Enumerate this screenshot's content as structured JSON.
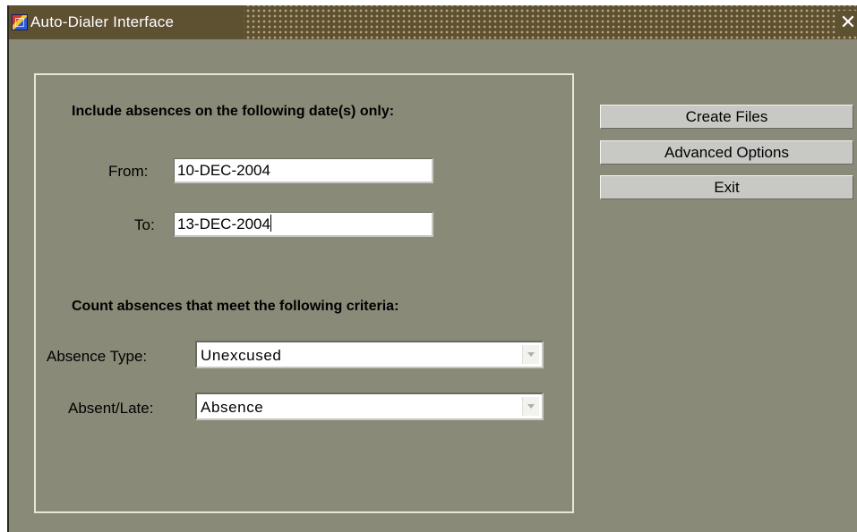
{
  "window": {
    "title": "Auto-Dialer Interface",
    "close_symbol": "✕"
  },
  "date_section": {
    "heading": "Include absences on the following date(s) only:",
    "from_label": "From:",
    "from_value": "10-DEC-2004",
    "to_label": "To:",
    "to_value": "13-DEC-2004"
  },
  "criteria_section": {
    "heading": "Count absences that meet the following criteria:",
    "absence_type_label": "Absence Type:",
    "absence_type_value": "Unexcused",
    "absent_late_label": "Absent/Late:",
    "absent_late_value": "Absence"
  },
  "buttons": {
    "create_files": "Create Files",
    "advanced_options": "Advanced Options",
    "exit": "Exit"
  },
  "colors": {
    "window_bg": "#8a8a78",
    "titlebar_bg": "#5e5132",
    "button_bg": "#c8c8c4"
  }
}
